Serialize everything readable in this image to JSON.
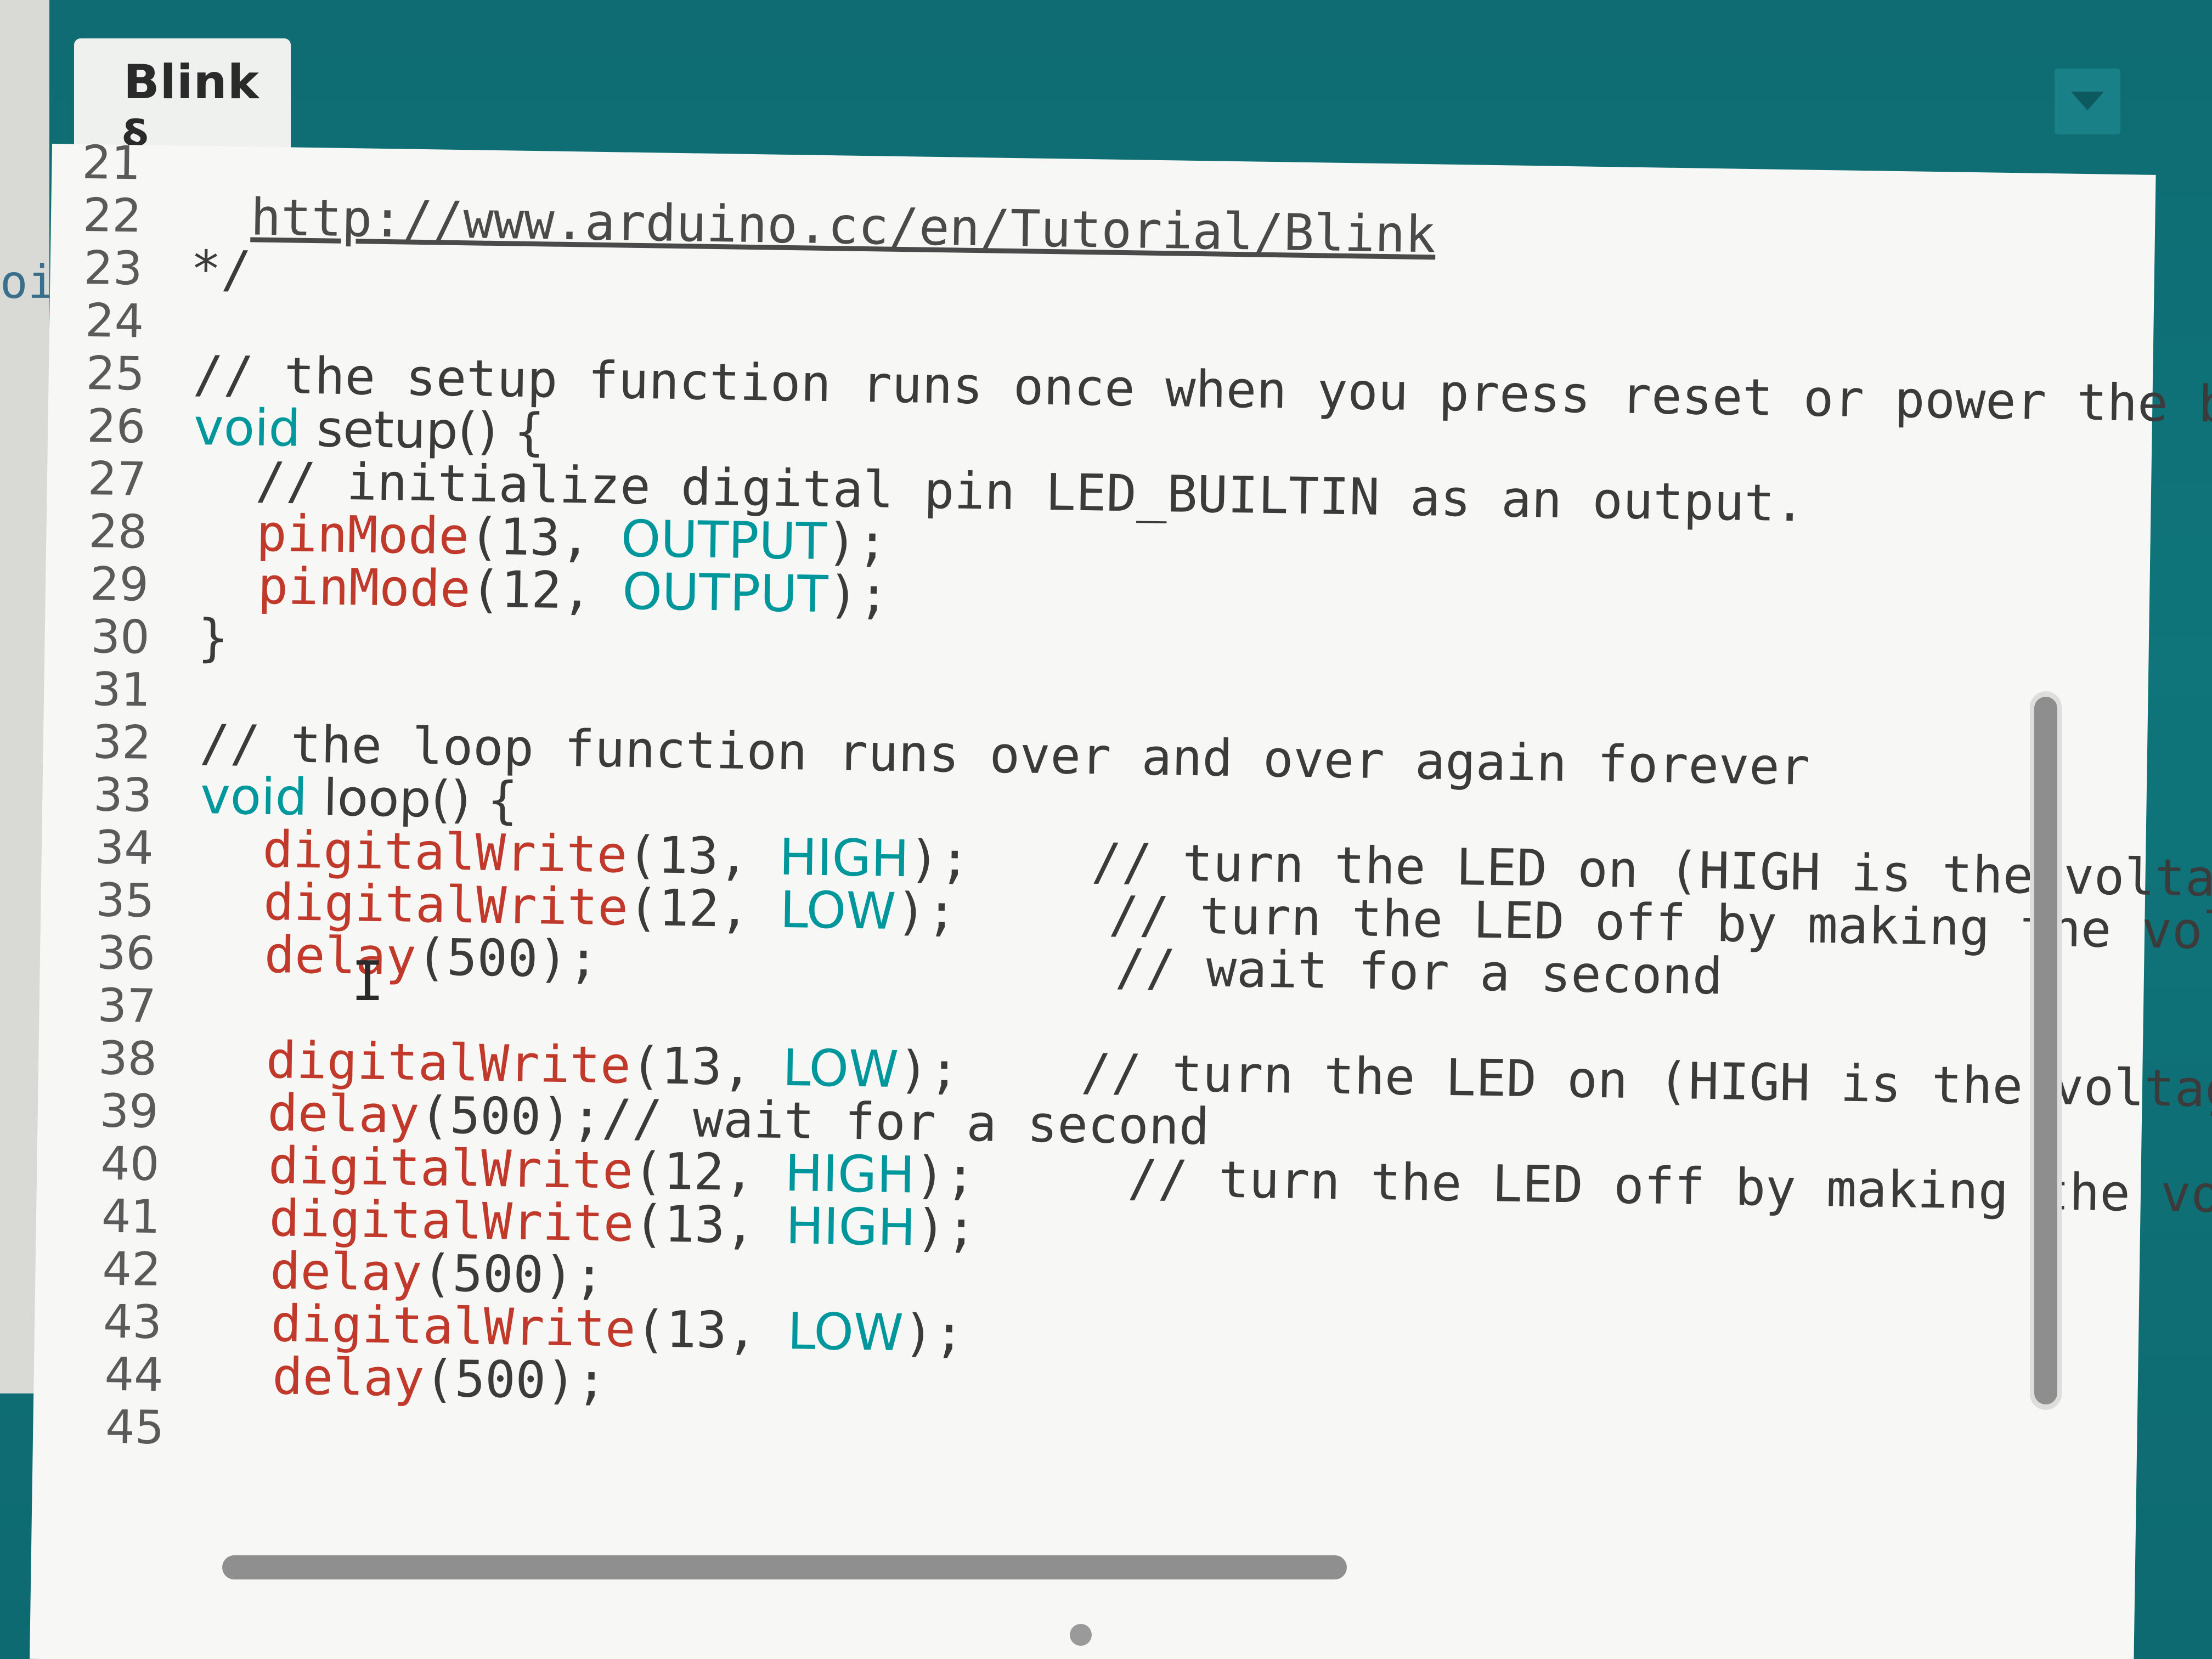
{
  "tab": {
    "label": "Blink §"
  },
  "left_fragment": "oi",
  "lines": [
    {
      "n": "21",
      "parts": []
    },
    {
      "n": "22",
      "parts": [
        {
          "t": "  "
        },
        {
          "t": "http://www.arduino.cc/en/Tutorial/Blink",
          "c": "link"
        }
      ]
    },
    {
      "n": "23",
      "parts": [
        {
          "t": "*/"
        }
      ]
    },
    {
      "n": "24",
      "parts": []
    },
    {
      "n": "25",
      "parts": [
        {
          "t": "// the setup function runs once when you press reset or power the board"
        }
      ]
    },
    {
      "n": "26",
      "parts": [
        {
          "t": "void",
          "c": "kw-type"
        },
        {
          "t": " setup() {",
          "c": "plain-sans"
        }
      ]
    },
    {
      "n": "27",
      "parts": [
        {
          "t": "  // initialize digital pin LED_BUILTIN as an output."
        }
      ]
    },
    {
      "n": "28",
      "parts": [
        {
          "t": "  "
        },
        {
          "t": "pinMode",
          "c": "kw-red"
        },
        {
          "t": "(13, "
        },
        {
          "t": "OUTPUT",
          "c": "kw-const"
        },
        {
          "t": ");"
        }
      ]
    },
    {
      "n": "29",
      "parts": [
        {
          "t": "  "
        },
        {
          "t": "pinMode",
          "c": "kw-red"
        },
        {
          "t": "(12, "
        },
        {
          "t": "OUTPUT",
          "c": "kw-const"
        },
        {
          "t": ");"
        }
      ]
    },
    {
      "n": "30",
      "parts": [
        {
          "t": "}"
        }
      ]
    },
    {
      "n": "31",
      "parts": []
    },
    {
      "n": "32",
      "parts": [
        {
          "t": "// the loop function runs over and over again forever"
        }
      ]
    },
    {
      "n": "33",
      "parts": [
        {
          "t": "void",
          "c": "kw-type"
        },
        {
          "t": " loop() {",
          "c": "plain-sans"
        }
      ]
    },
    {
      "n": "34",
      "parts": [
        {
          "t": "  "
        },
        {
          "t": "digitalWrite",
          "c": "kw-red"
        },
        {
          "t": "(13, "
        },
        {
          "t": "HIGH",
          "c": "kw-const"
        },
        {
          "t": ");    // turn the LED on (HIGH is the voltage level)"
        }
      ]
    },
    {
      "n": "35",
      "parts": [
        {
          "t": "  "
        },
        {
          "t": "digitalWrite",
          "c": "kw-red"
        },
        {
          "t": "(12, "
        },
        {
          "t": "LOW",
          "c": "kw-const"
        },
        {
          "t": ");     // turn the LED off by making the voltage LOW"
        }
      ]
    },
    {
      "n": "36",
      "parts": [
        {
          "t": "  "
        },
        {
          "t": "delay",
          "c": "kw-red"
        },
        {
          "t": "(500);                 // wait for a second"
        }
      ]
    },
    {
      "n": "37",
      "parts": []
    },
    {
      "n": "38",
      "parts": [
        {
          "t": "  "
        },
        {
          "t": "digitalWrite",
          "c": "kw-red"
        },
        {
          "t": "(13, "
        },
        {
          "t": "LOW",
          "c": "kw-const"
        },
        {
          "t": ");    // turn the LED on (HIGH is the voltage level)"
        }
      ]
    },
    {
      "n": "39",
      "parts": [
        {
          "t": "  "
        },
        {
          "t": "delay",
          "c": "kw-red"
        },
        {
          "t": "(500);// wait for a second"
        }
      ]
    },
    {
      "n": "40",
      "parts": [
        {
          "t": "  "
        },
        {
          "t": "digitalWrite",
          "c": "kw-red"
        },
        {
          "t": "(12, "
        },
        {
          "t": "HIGH",
          "c": "kw-const"
        },
        {
          "t": ");     // turn the LED off by making the voltage LOW"
        }
      ]
    },
    {
      "n": "41",
      "parts": [
        {
          "t": "  "
        },
        {
          "t": "digitalWrite",
          "c": "kw-red"
        },
        {
          "t": "(13, "
        },
        {
          "t": "HIGH",
          "c": "kw-const"
        },
        {
          "t": ");"
        }
      ]
    },
    {
      "n": "42",
      "parts": [
        {
          "t": "  "
        },
        {
          "t": "delay",
          "c": "kw-red"
        },
        {
          "t": "(500);"
        }
      ]
    },
    {
      "n": "43",
      "parts": [
        {
          "t": "  "
        },
        {
          "t": "digitalWrite",
          "c": "kw-red"
        },
        {
          "t": "(13, "
        },
        {
          "t": "LOW",
          "c": "kw-const"
        },
        {
          "t": ");"
        }
      ]
    },
    {
      "n": "44",
      "parts": [
        {
          "t": "  "
        },
        {
          "t": "delay",
          "c": "kw-red"
        },
        {
          "t": "(500);"
        }
      ]
    },
    {
      "n": "45",
      "parts": []
    }
  ],
  "icons": {
    "tab_menu": "chevron-down-icon",
    "text_cursor": "text-cursor-icon"
  },
  "colors": {
    "ide_teal": "#0f757b",
    "editor_bg": "#f7f8f5",
    "keyword_teal": "#00979c",
    "function_red": "#c0392b"
  }
}
